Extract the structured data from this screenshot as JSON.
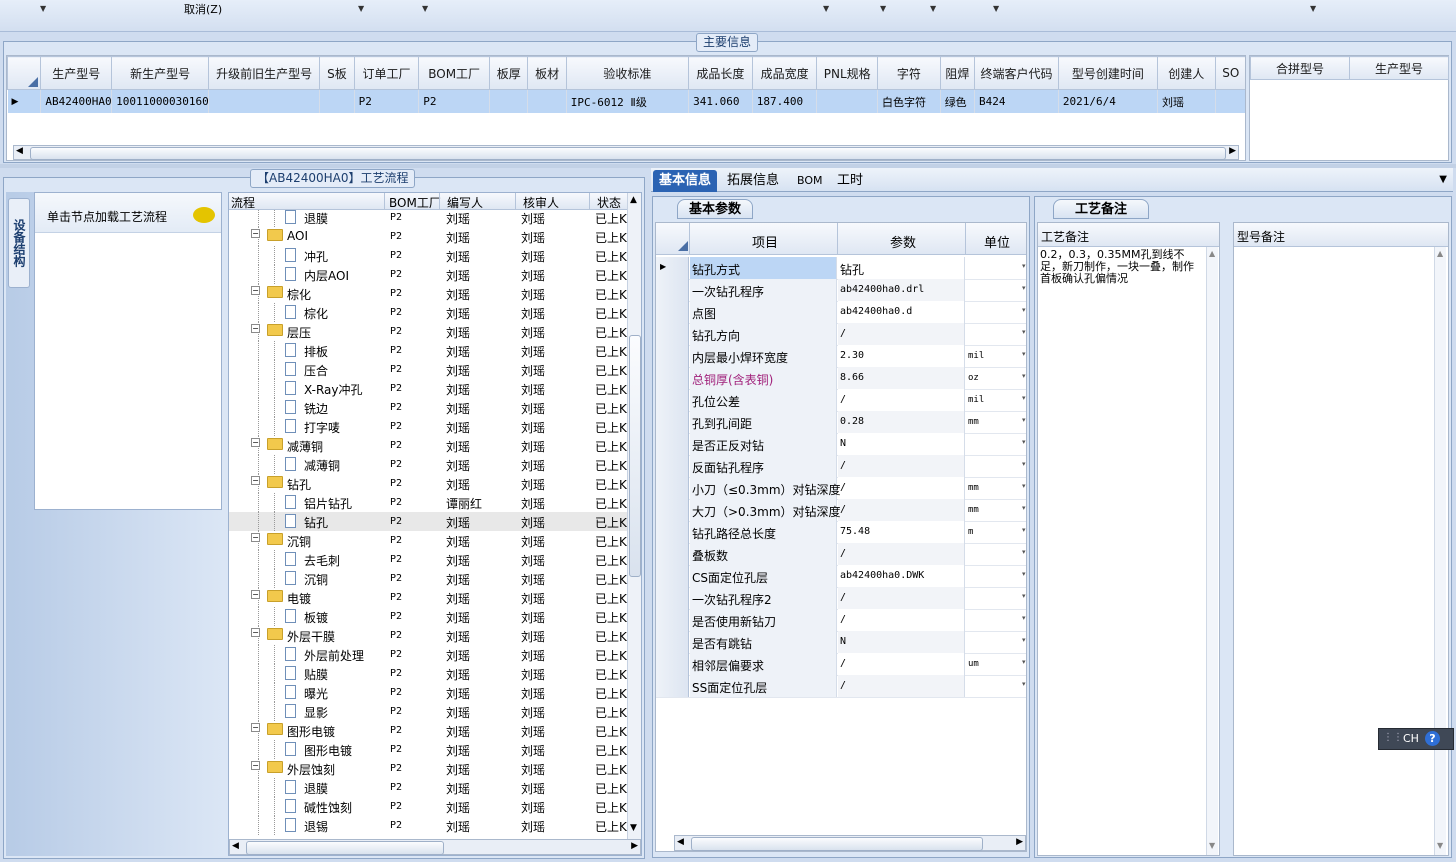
{
  "toolbar": {
    "cancel_label": "取消(Z)"
  },
  "main_info": {
    "title": "主要信息",
    "columns": [
      "生产型号",
      "新生产型号",
      "升级前旧生产型号",
      "S板",
      "订单工厂",
      "BOM工厂",
      "板厚",
      "板材",
      "验收标准",
      "成品长度",
      "成品宽度",
      "PNL规格",
      "字符",
      "阻焊",
      "终端客户代码",
      "型号创建时间",
      "创建人",
      "SO"
    ],
    "row": [
      "AB42400HA0",
      "10011000030160",
      "",
      "",
      "P2",
      "P2",
      "",
      "",
      "IPC-6012 Ⅱ级",
      "341.060",
      "187.400",
      "",
      "白色字符",
      "绿色",
      "B424",
      "2021/6/4",
      "刘瑶",
      ""
    ],
    "side_columns": [
      "合拼型号",
      "生产型号"
    ]
  },
  "process": {
    "title": "【AB42400HA0】工艺流程",
    "side_tab": "设备结构",
    "load_hint": "单击节点加载工艺流程",
    "columns": [
      "流程",
      "BOM工厂",
      "编写人",
      "核审人",
      "状态"
    ],
    "rows": [
      {
        "level": 2,
        "name": "退膜",
        "bom": "P2",
        "writer": "刘瑶",
        "reviewer": "刘瑶",
        "status": "已上K"
      },
      {
        "level": 1,
        "name": "AOI",
        "bom": "P2",
        "writer": "刘瑶",
        "reviewer": "刘瑶",
        "status": "已上K"
      },
      {
        "level": 2,
        "name": "冲孔",
        "bom": "P2",
        "writer": "刘瑶",
        "reviewer": "刘瑶",
        "status": "已上K"
      },
      {
        "level": 2,
        "name": "内层AOI",
        "bom": "P2",
        "writer": "刘瑶",
        "reviewer": "刘瑶",
        "status": "已上K"
      },
      {
        "level": 1,
        "name": "棕化",
        "bom": "P2",
        "writer": "刘瑶",
        "reviewer": "刘瑶",
        "status": "已上K"
      },
      {
        "level": 2,
        "name": "棕化",
        "bom": "P2",
        "writer": "刘瑶",
        "reviewer": "刘瑶",
        "status": "已上K"
      },
      {
        "level": 1,
        "name": "层压",
        "bom": "P2",
        "writer": "刘瑶",
        "reviewer": "刘瑶",
        "status": "已上K"
      },
      {
        "level": 2,
        "name": "排板",
        "bom": "P2",
        "writer": "刘瑶",
        "reviewer": "刘瑶",
        "status": "已上K"
      },
      {
        "level": 2,
        "name": "压合",
        "bom": "P2",
        "writer": "刘瑶",
        "reviewer": "刘瑶",
        "status": "已上K"
      },
      {
        "level": 2,
        "name": "X-Ray冲孔",
        "bom": "P2",
        "writer": "刘瑶",
        "reviewer": "刘瑶",
        "status": "已上K"
      },
      {
        "level": 2,
        "name": "铣边",
        "bom": "P2",
        "writer": "刘瑶",
        "reviewer": "刘瑶",
        "status": "已上K"
      },
      {
        "level": 2,
        "name": "打字唛",
        "bom": "P2",
        "writer": "刘瑶",
        "reviewer": "刘瑶",
        "status": "已上K"
      },
      {
        "level": 1,
        "name": "减薄铜",
        "bom": "P2",
        "writer": "刘瑶",
        "reviewer": "刘瑶",
        "status": "已上K"
      },
      {
        "level": 2,
        "name": "减薄铜",
        "bom": "P2",
        "writer": "刘瑶",
        "reviewer": "刘瑶",
        "status": "已上K"
      },
      {
        "level": 1,
        "name": "钻孔",
        "bom": "P2",
        "writer": "刘瑶",
        "reviewer": "刘瑶",
        "status": "已上K"
      },
      {
        "level": 2,
        "name": "铝片钻孔",
        "bom": "P2",
        "writer": "谭丽红",
        "reviewer": "刘瑶",
        "status": "已上K"
      },
      {
        "level": 2,
        "name": "钻孔",
        "bom": "P2",
        "writer": "刘瑶",
        "reviewer": "刘瑶",
        "status": "已上K",
        "selected": true
      },
      {
        "level": 1,
        "name": "沉铜",
        "bom": "P2",
        "writer": "刘瑶",
        "reviewer": "刘瑶",
        "status": "已上K"
      },
      {
        "level": 2,
        "name": "去毛刺",
        "bom": "P2",
        "writer": "刘瑶",
        "reviewer": "刘瑶",
        "status": "已上K"
      },
      {
        "level": 2,
        "name": "沉铜",
        "bom": "P2",
        "writer": "刘瑶",
        "reviewer": "刘瑶",
        "status": "已上K"
      },
      {
        "level": 1,
        "name": "电镀",
        "bom": "P2",
        "writer": "刘瑶",
        "reviewer": "刘瑶",
        "status": "已上K"
      },
      {
        "level": 2,
        "name": "板镀",
        "bom": "P2",
        "writer": "刘瑶",
        "reviewer": "刘瑶",
        "status": "已上K"
      },
      {
        "level": 1,
        "name": "外层干膜",
        "bom": "P2",
        "writer": "刘瑶",
        "reviewer": "刘瑶",
        "status": "已上K"
      },
      {
        "level": 2,
        "name": "外层前处理",
        "bom": "P2",
        "writer": "刘瑶",
        "reviewer": "刘瑶",
        "status": "已上K"
      },
      {
        "level": 2,
        "name": "贴膜",
        "bom": "P2",
        "writer": "刘瑶",
        "reviewer": "刘瑶",
        "status": "已上K"
      },
      {
        "level": 2,
        "name": "曝光",
        "bom": "P2",
        "writer": "刘瑶",
        "reviewer": "刘瑶",
        "status": "已上K"
      },
      {
        "level": 2,
        "name": "显影",
        "bom": "P2",
        "writer": "刘瑶",
        "reviewer": "刘瑶",
        "status": "已上K"
      },
      {
        "level": 1,
        "name": "图形电镀",
        "bom": "P2",
        "writer": "刘瑶",
        "reviewer": "刘瑶",
        "status": "已上K"
      },
      {
        "level": 2,
        "name": "图形电镀",
        "bom": "P2",
        "writer": "刘瑶",
        "reviewer": "刘瑶",
        "status": "已上K"
      },
      {
        "level": 1,
        "name": "外层蚀刻",
        "bom": "P2",
        "writer": "刘瑶",
        "reviewer": "刘瑶",
        "status": "已上K"
      },
      {
        "level": 2,
        "name": "退膜",
        "bom": "P2",
        "writer": "刘瑶",
        "reviewer": "刘瑶",
        "status": "已上K"
      },
      {
        "level": 2,
        "name": "碱性蚀刻",
        "bom": "P2",
        "writer": "刘瑶",
        "reviewer": "刘瑶",
        "status": "已上K"
      },
      {
        "level": 2,
        "name": "退锡",
        "bom": "P2",
        "writer": "刘瑶",
        "reviewer": "刘瑶",
        "status": "已上K"
      }
    ]
  },
  "detail_tabs": [
    "基本信息",
    "拓展信息",
    "BOM",
    "工时"
  ],
  "basic_params": {
    "title": "基本参数",
    "columns": [
      "项目",
      "参数",
      "单位"
    ],
    "rows": [
      {
        "item": "钻孔方式",
        "value": "钻孔",
        "unit": ""
      },
      {
        "item": "一次钻孔程序",
        "value": "ab42400ha0.drl",
        "unit": ""
      },
      {
        "item": "点图",
        "value": "ab42400ha0.d",
        "unit": ""
      },
      {
        "item": "钻孔方向",
        "value": "/",
        "unit": ""
      },
      {
        "item": "内层最小焊环宽度",
        "value": "2.30",
        "unit": "mil"
      },
      {
        "item": "总铜厚(含表铜)",
        "value": "8.66",
        "unit": "oz",
        "highlight": true
      },
      {
        "item": "孔位公差",
        "value": "/",
        "unit": "mil"
      },
      {
        "item": "孔到孔间距",
        "value": "0.28",
        "unit": "mm"
      },
      {
        "item": "是否正反对钻",
        "value": "N",
        "unit": ""
      },
      {
        "item": "反面钻孔程序",
        "value": "/",
        "unit": ""
      },
      {
        "item": "小刀（≤0.3mm）对钻深度",
        "value": "/",
        "unit": "mm"
      },
      {
        "item": "大刀（>0.3mm）对钻深度",
        "value": "/",
        "unit": "mm"
      },
      {
        "item": "钻孔路径总长度",
        "value": "75.48",
        "unit": "m"
      },
      {
        "item": "叠板数",
        "value": "/",
        "unit": ""
      },
      {
        "item": "CS面定位孔层",
        "value": "ab42400ha0.DWK",
        "unit": ""
      },
      {
        "item": "一次钻孔程序2",
        "value": "/",
        "unit": ""
      },
      {
        "item": "是否使用新钻刀",
        "value": "/",
        "unit": ""
      },
      {
        "item": "是否有跳钻",
        "value": "N",
        "unit": ""
      },
      {
        "item": "相邻层偏要求",
        "value": "/",
        "unit": "um"
      },
      {
        "item": "SS面定位孔层",
        "value": "/",
        "unit": ""
      }
    ]
  },
  "remarks": {
    "title": "工艺备注",
    "columns": [
      "工艺备注",
      "型号备注"
    ],
    "process_note": "0.2，0.3，0.35MM孔到线不足，新刀制作，一块一叠，制作首板确认孔偏情况",
    "model_note": ""
  },
  "ime": {
    "label": "CH"
  },
  "colors": {
    "selection": "#bcd6f5",
    "accent_tab": "#2b63b3",
    "highlight_text": "#a0207a"
  }
}
